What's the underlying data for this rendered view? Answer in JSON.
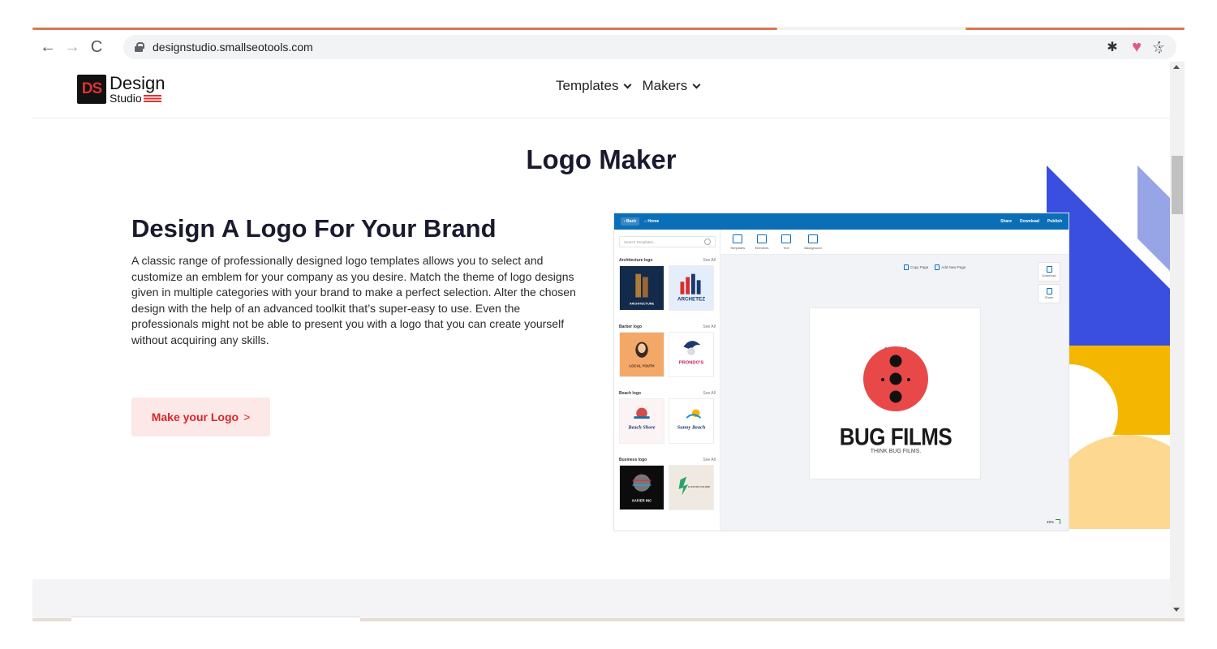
{
  "browser": {
    "url": "designstudio.smallseotools.com"
  },
  "site": {
    "logo": {
      "mark": "DS",
      "word1": "Design",
      "word2": "Studio"
    },
    "nav": [
      {
        "label": "Templates"
      },
      {
        "label": "Makers"
      }
    ]
  },
  "main": {
    "title": "Logo Maker",
    "heading": "Design A Logo For Your Brand",
    "description": "A classic range of professionally designed logo templates allows you to select and customize an emblem for your company as you desire. Match the theme of logo designs given in multiple categories with your brand to make a perfect selection. Alter the chosen design with the help of an advanced toolkit that’s super-easy to use. Even the professionals might not be able to present you with a logo that you can create yourself without acquiring any skills.",
    "cta": {
      "label": "Make your Logo",
      "arrow": ">"
    }
  },
  "mockup": {
    "topbar": {
      "back": "‹ Back",
      "home": "⌂ Home",
      "share": "Share",
      "download": "Download",
      "publish": "Publish"
    },
    "search_placeholder": "Search Templates...",
    "see_all": "See All",
    "categories": [
      {
        "name": "Architecture logo",
        "thumbs": [
          "ARCHITECTURE",
          "ARCHETEZ"
        ]
      },
      {
        "name": "Barber logo",
        "thumbs": [
          "LOCAL YOUTH",
          "PRONDO'S"
        ]
      },
      {
        "name": "Beach logo",
        "thumbs": [
          "Beach Shore",
          "Sunny Beach"
        ]
      },
      {
        "name": "Business logo",
        "thumbs": [
          "XAFIER INC",
          "ELECTRIC FOLDER"
        ]
      }
    ],
    "tools": [
      "Templates",
      "Elements",
      "Text",
      "Background"
    ],
    "copy_page": "Copy Page",
    "add_page": "Add New Page",
    "side_actions": [
      "Download",
      "Share"
    ],
    "design": {
      "brand": "BUG FILMS",
      "tagline": "THINK BUG FILMS."
    },
    "zoom": "48%"
  },
  "colors": {
    "accent_red": "#d7262b",
    "cta_bg": "#fde8e8",
    "editor_blue": "#0b6fb8",
    "shape_blue": "#3a4fe0",
    "shape_light_blue": "#97a4e6",
    "shape_yellow": "#f5b600",
    "shape_light_yellow": "#fdd891",
    "ladybug_red": "#e84848"
  }
}
